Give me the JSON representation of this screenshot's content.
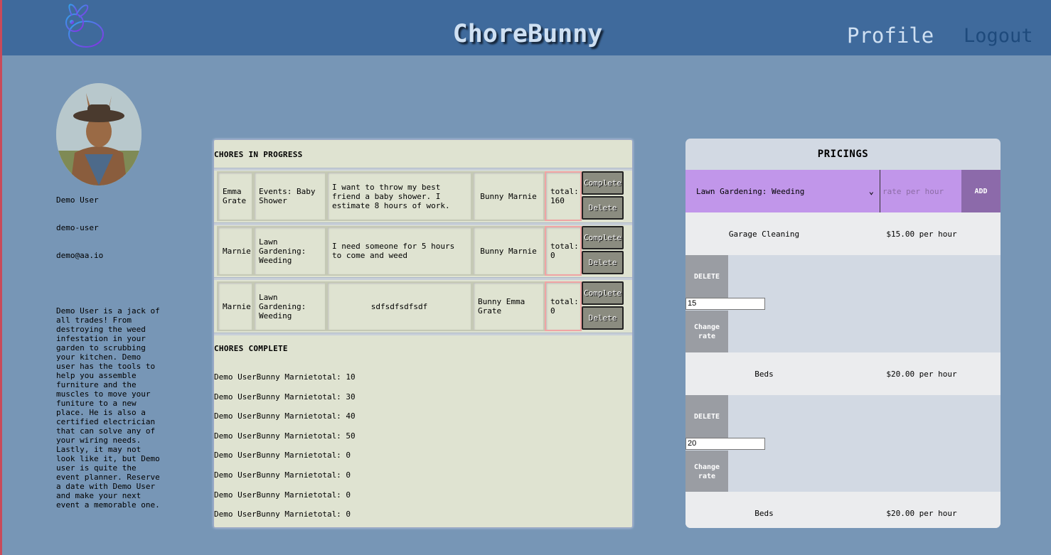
{
  "header": {
    "title": "ChoreBunny",
    "nav_profile": "Profile",
    "nav_logout": "Logout",
    "logo_icon": "bunny-logo-icon"
  },
  "user": {
    "name": "Demo User",
    "username": "demo-user",
    "email": "demo@aa.io",
    "bio": "Demo User is a jack of all trades! From destroying the weed infestation in your garden to scrubbing your kitchen. Demo user has the tools to help you assemble furniture and the muscles to move your funiture to a new place. He is also a certified electrician that can solve any of your wiring needs. Lastly, it may not look like it, but Demo user is quite the event planner. Reserve a date with Demo User and make your next event a memorable one."
  },
  "chores": {
    "in_progress_title": "CHORES IN PROGRESS",
    "complete_title": "CHORES COMPLETE",
    "complete_label": "Complete",
    "delete_label": "Delete",
    "in_progress": [
      {
        "client": "Emma Grate",
        "category": "Events: Baby Shower",
        "description": "I want to throw my best friend a baby shower. I estimate 8 hours of work.",
        "bunny": "Bunny Marnie",
        "total": "total: 160"
      },
      {
        "client": "Marnie",
        "category": "Lawn Gardening: Weeding",
        "description": "I need someone for 5 hours to come and weed",
        "bunny": "Bunny Marnie",
        "total": "total: 0"
      },
      {
        "client": "Marnie",
        "category": "Lawn Gardening: Weeding",
        "description": "sdfsdfsdfsdf",
        "bunny": "Bunny Emma Grate",
        "total": "total: 0"
      }
    ],
    "completed": [
      "Demo UserBunny Marnietotal: 10",
      "Demo UserBunny Marnietotal: 30",
      "Demo UserBunny Marnietotal: 40",
      "Demo UserBunny Marnietotal: 50",
      "Demo UserBunny Marnietotal: 0",
      "Demo UserBunny Marnietotal: 0",
      "Demo UserBunny Marnietotal: 0",
      "Demo UserBunny Marnietotal: 0"
    ]
  },
  "pricings": {
    "title": "PRICINGS",
    "select_value": "Lawn Gardening: Weeding",
    "rate_placeholder": "rate per hour",
    "add_label": "ADD",
    "delete_label": "DELETE",
    "change_rate_label": "Change rate",
    "items": [
      {
        "name": "Garage Cleaning",
        "amount": "$15.00 per hour",
        "rate_value": "15"
      },
      {
        "name": "Beds",
        "amount": "$20.00 per hour",
        "rate_value": "20"
      },
      {
        "name": "Beds",
        "amount": "$20.00 per hour"
      }
    ]
  },
  "colors": {
    "header": "#3f6a9c",
    "page": "#7796b6",
    "add_bar": "#c196ea",
    "add_button": "#8c6aaa"
  }
}
